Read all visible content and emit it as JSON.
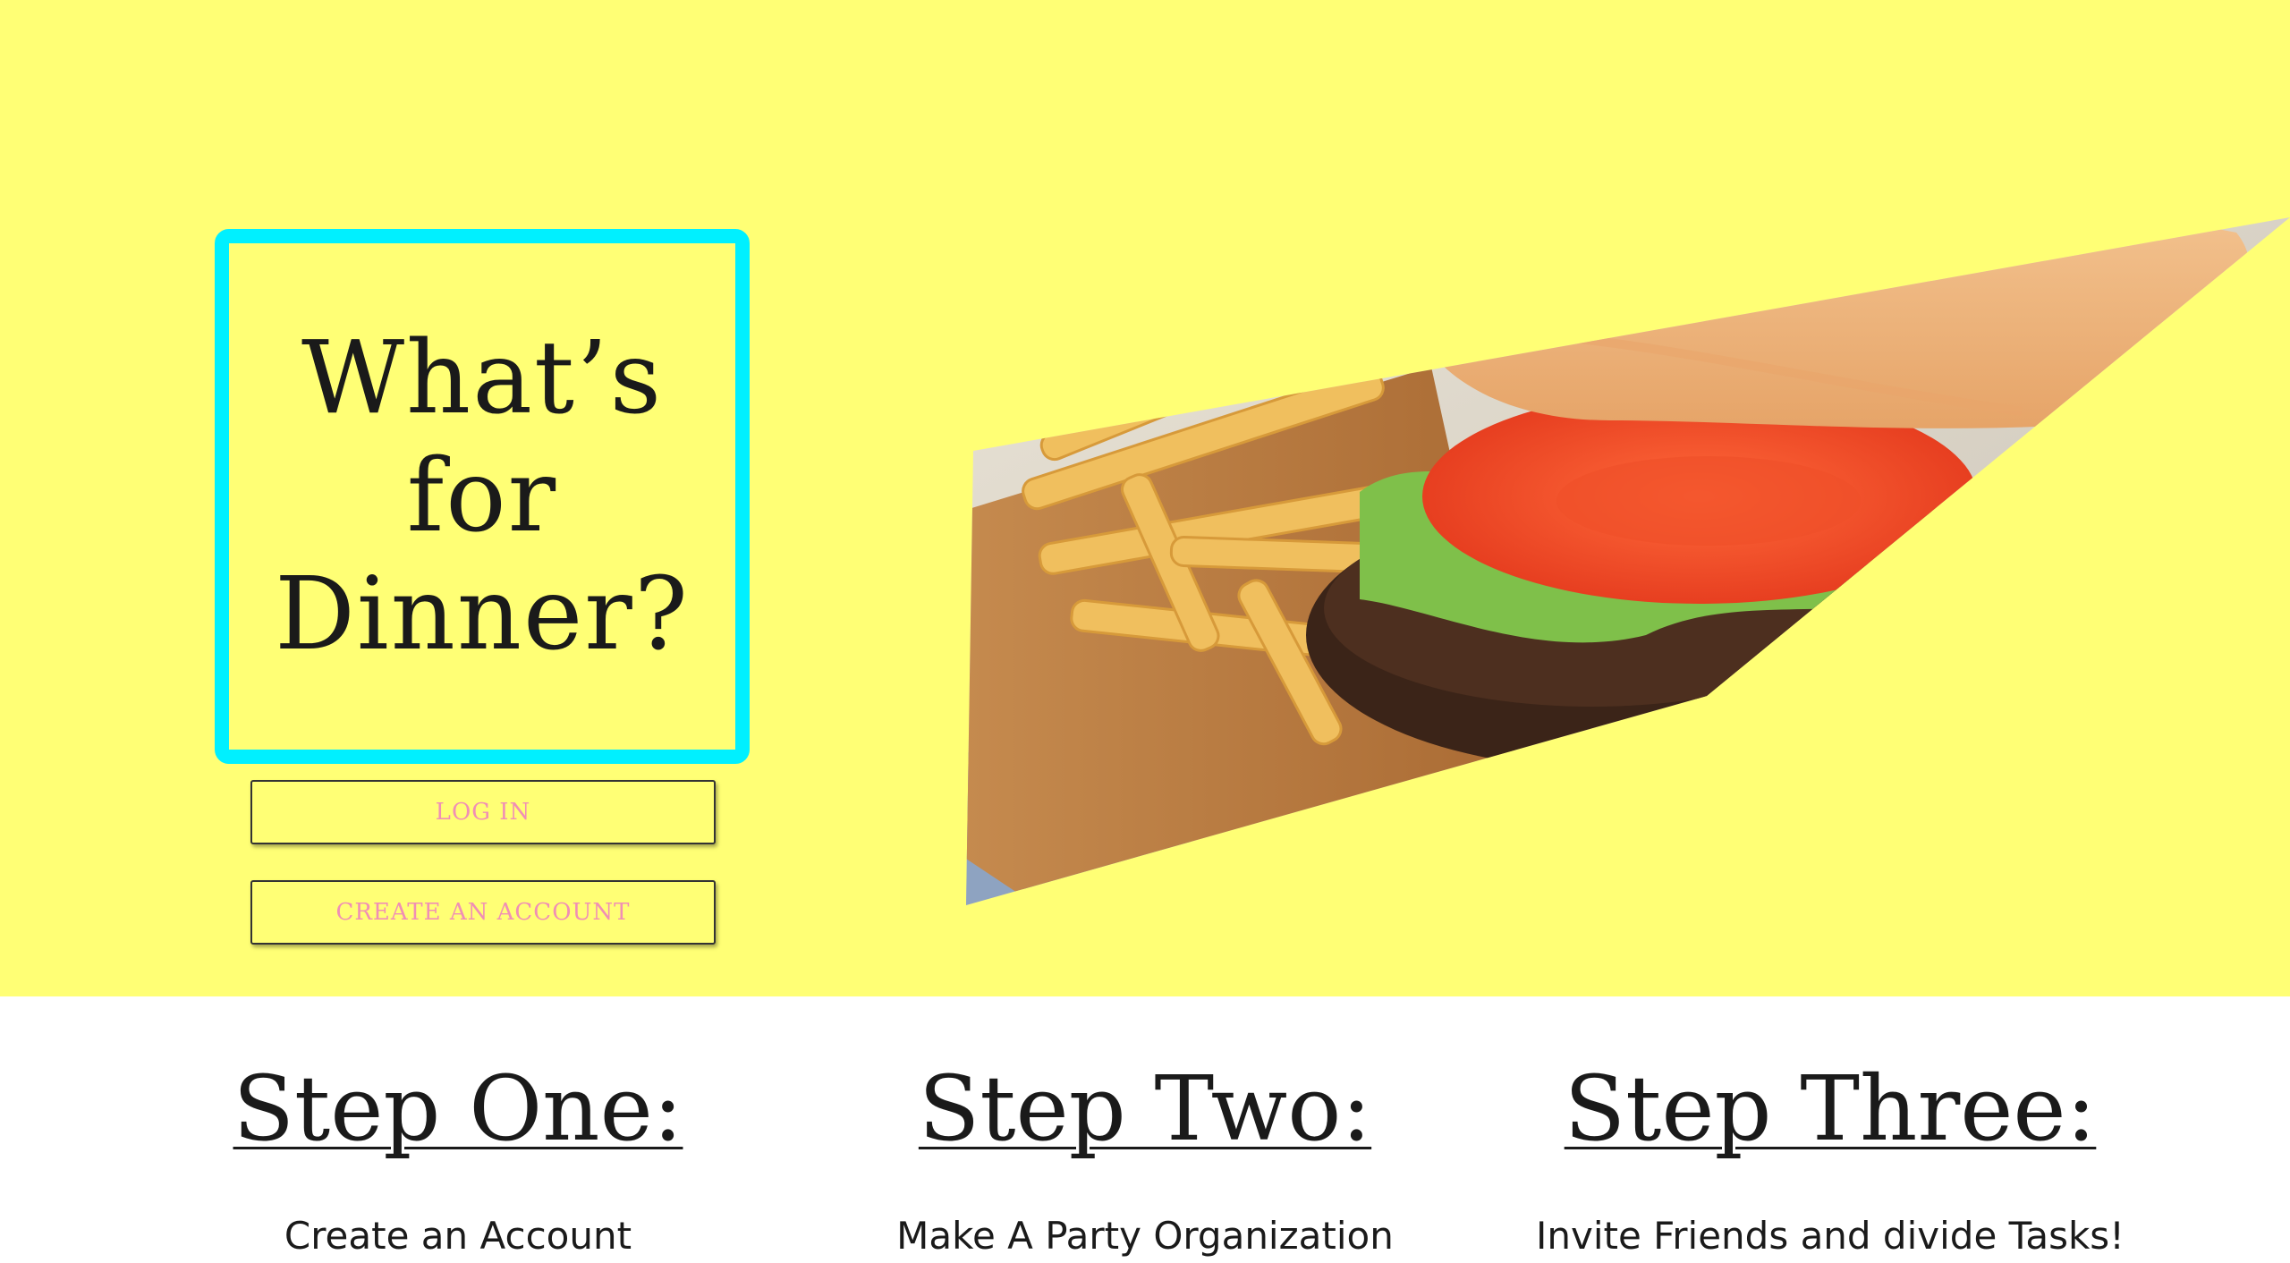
{
  "hero": {
    "title": "What’s for Dinner?",
    "background_color": "#ffff75",
    "frame_color": "#00f0ff",
    "login_label": "LOG IN",
    "create_account_label": "CREATE AN ACCOUNT",
    "button_text_color": "#f08fb5",
    "image_subject": "burger-and-fries-photo"
  },
  "steps": [
    {
      "heading": "Step One:",
      "text": "Create an Account"
    },
    {
      "heading": "Step Two:",
      "text": "Make A Party Organization"
    },
    {
      "heading": "Step Three:",
      "text": "Invite Friends and divide Tasks!"
    }
  ]
}
